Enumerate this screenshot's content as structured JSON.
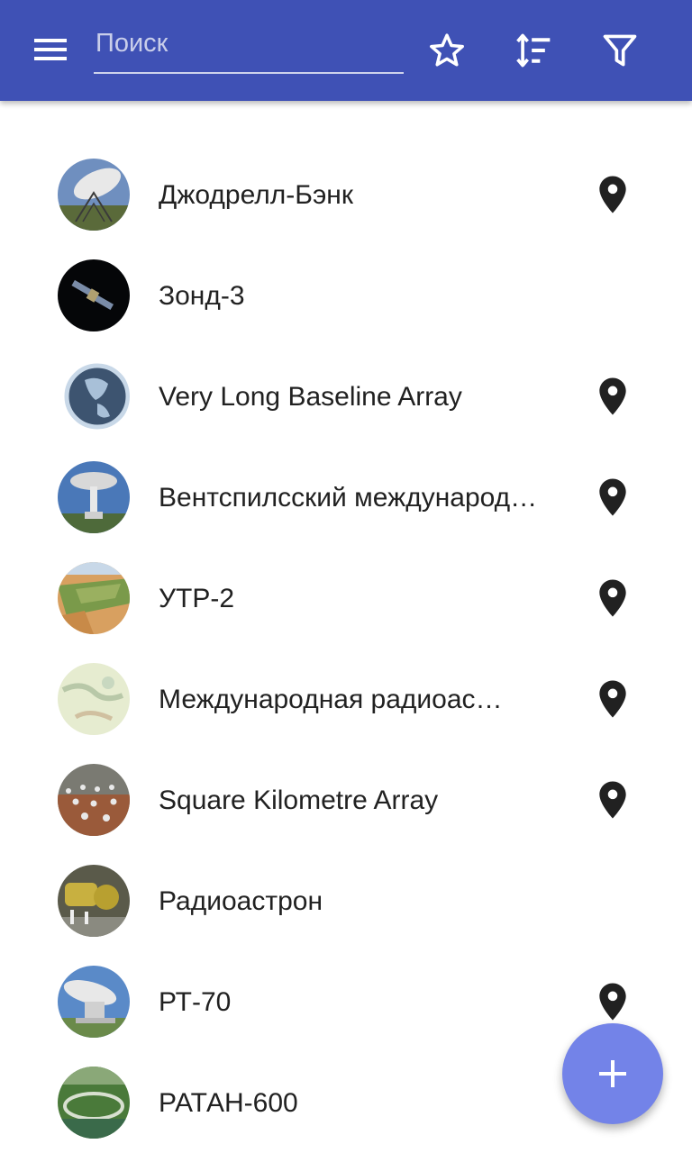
{
  "toolbar": {
    "background": "#3f51b5",
    "menu_icon": "menu-icon",
    "search": {
      "placeholder": "Поиск",
      "value": ""
    },
    "favorite_icon": "star-outline-icon",
    "sort_icon": "sort-icon",
    "filter_icon": "filter-icon"
  },
  "list": {
    "items": [
      {
        "label": "Джодрелл-Бэнк",
        "has_location": true
      },
      {
        "label": "Зонд-3",
        "has_location": false
      },
      {
        "label": "Very Long Baseline Array",
        "has_location": true
      },
      {
        "label": "Вентспилсский международ…",
        "has_location": true
      },
      {
        "label": "УТР-2",
        "has_location": true
      },
      {
        "label": "Международная радиоас…",
        "has_location": true
      },
      {
        "label": "Square Kilometre Array",
        "has_location": true
      },
      {
        "label": "Радиоастрон",
        "has_location": false
      },
      {
        "label": "РТ-70",
        "has_location": true
      },
      {
        "label": "РАТАН-600",
        "has_location": false
      }
    ]
  },
  "fab": {
    "icon": "plus-icon",
    "color": "#7383e8"
  }
}
